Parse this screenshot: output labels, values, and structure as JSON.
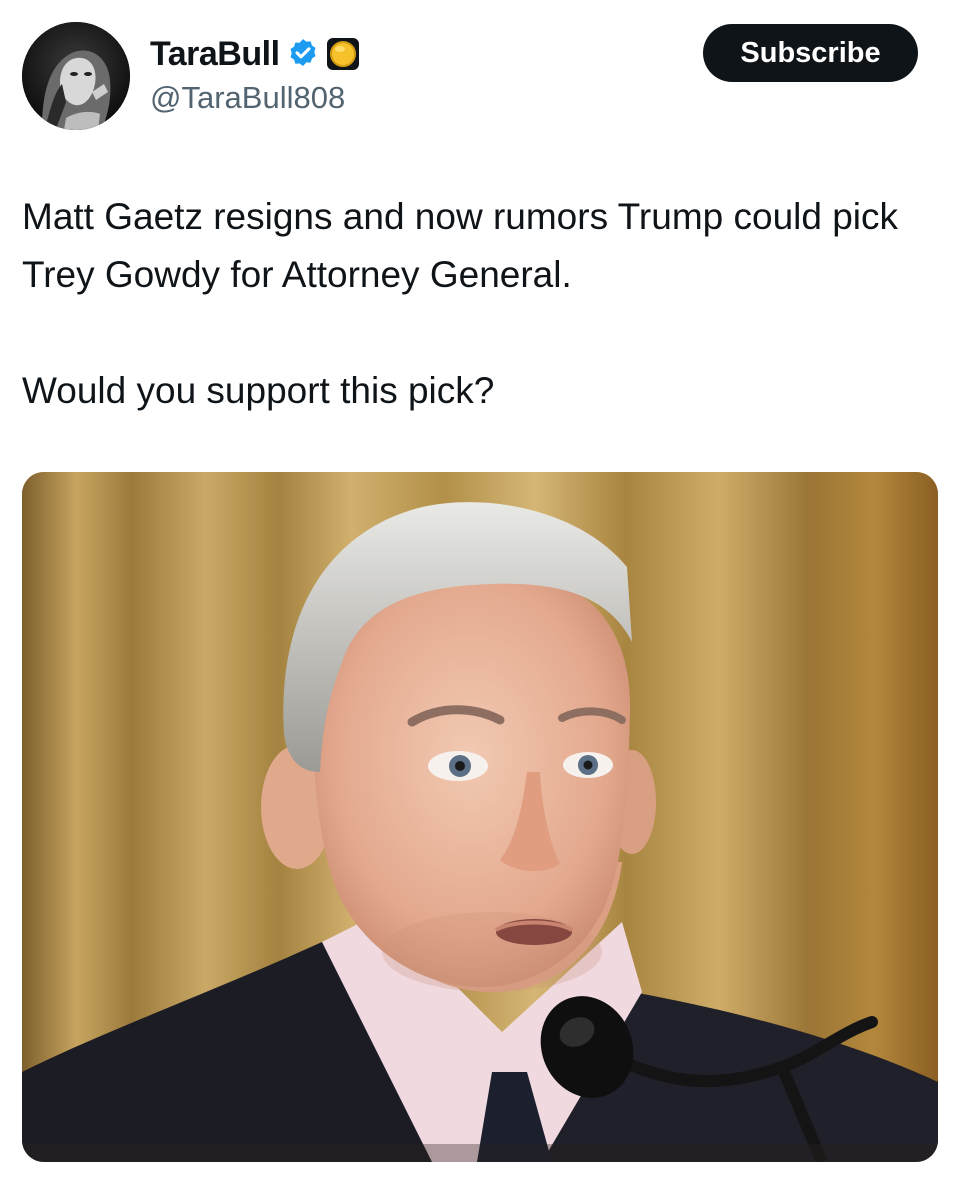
{
  "post": {
    "author": {
      "display_name": "TaraBull",
      "handle": "@TaraBull808",
      "avatar_icon": "profile-photo",
      "badges": [
        "verified-check-icon",
        "gold-coin-badge-icon"
      ],
      "verified_color": "#1d9bf0"
    },
    "subscribe_label": "Subscribe",
    "text": "Matt Gaetz resigns and now rumors Trump could pick Trey Gowdy for Attorney General.\n\nWould you support this pick?",
    "media": {
      "kind": "photo",
      "icon": "photo-man-at-microphone"
    }
  },
  "colors": {
    "text": "#0f1419",
    "secondary_text": "#536471",
    "button_bg": "#0f1419",
    "button_text": "#ffffff"
  }
}
